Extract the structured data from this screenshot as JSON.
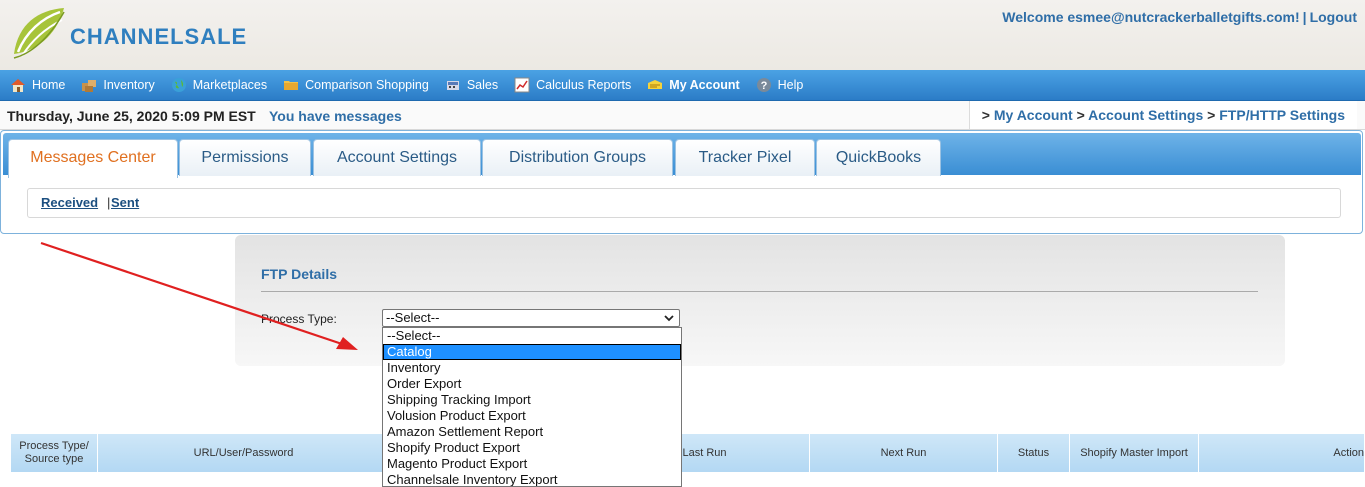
{
  "header": {
    "logo_text": "CHANNELSALE",
    "welcome": "Welcome esmee@nutcrackerballetgifts.com!",
    "separator": "|",
    "logout": "Logout"
  },
  "nav": {
    "items": [
      {
        "label": "Home",
        "icon": "home-icon"
      },
      {
        "label": "Inventory",
        "icon": "inventory-icon"
      },
      {
        "label": "Marketplaces",
        "icon": "globe-icon"
      },
      {
        "label": "Comparison Shopping",
        "icon": "folder-icon"
      },
      {
        "label": "Sales",
        "icon": "sales-icon"
      },
      {
        "label": "Calculus Reports",
        "icon": "chart-icon"
      },
      {
        "label": "My Account",
        "icon": "account-icon"
      },
      {
        "label": "Help",
        "icon": "help-icon"
      }
    ]
  },
  "datebar": {
    "date": "Thursday, June 25, 2020 5:09 PM EST",
    "messages": "You have messages"
  },
  "breadcrumb": {
    "gt1": ">",
    "my_account": "My Account",
    "gt2": ">",
    "account_settings": "Account Settings",
    "gt3": ">",
    "current": "FTP/HTTP Settings"
  },
  "tabs": [
    {
      "label": "Messages Center"
    },
    {
      "label": "Permissions"
    },
    {
      "label": "Account Settings"
    },
    {
      "label": "Distribution Groups"
    },
    {
      "label": "Tracker Pixel"
    },
    {
      "label": "QuickBooks"
    }
  ],
  "subtabs": {
    "received": "Received",
    "bar": "|",
    "sent": "Sent"
  },
  "ftp": {
    "title": "FTP Details",
    "process_type_label": "Process Type:",
    "selected_value": "--Select--",
    "options": [
      "--Select--",
      "Catalog",
      "Inventory",
      "Order Export",
      "Shipping Tracking Import",
      "Volusion Product Export",
      "Amazon Settlement Report",
      "Shopify Product Export",
      "Magento Product Export",
      "Channelsale Inventory Export"
    ],
    "highlighted_option": "Catalog"
  },
  "table": {
    "headers": [
      "Process Type/ Source type",
      "URL/User/Password",
      "",
      "Last Run",
      "Next Run",
      "Status",
      "Shopify Master Import",
      "Action"
    ]
  },
  "colors": {
    "nav_blue": "#2b7cc7",
    "link_blue": "#2f6ea7",
    "active_tab": "#e07020",
    "highlight": "#1e90ff",
    "arrow": "#e02020"
  }
}
